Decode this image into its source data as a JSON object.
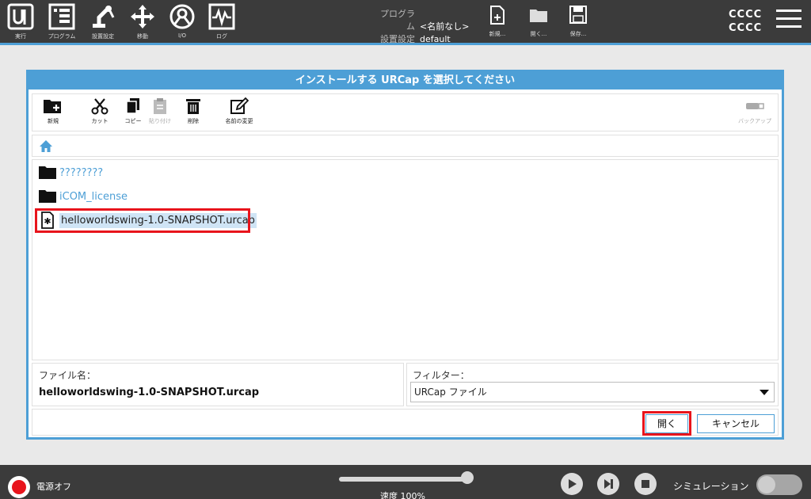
{
  "header": {
    "nav": [
      {
        "label": "実行",
        "icon": "ur-logo-icon"
      },
      {
        "label": "プログラム",
        "icon": "program-icon"
      },
      {
        "label": "設置設定",
        "icon": "robot-arm-icon"
      },
      {
        "label": "移動",
        "icon": "move-icon"
      },
      {
        "label": "I/O",
        "icon": "io-icon"
      },
      {
        "label": "ログ",
        "icon": "log-icon"
      }
    ],
    "program_key": "プログラム",
    "program_value": "<名前なし>",
    "installation_key": "設置設定",
    "installation_value": "default",
    "file_buttons": [
      {
        "label": "新規...",
        "icon": "new-file-icon"
      },
      {
        "label": "開く...",
        "icon": "open-folder-icon"
      },
      {
        "label": "保存...",
        "icon": "save-icon"
      }
    ],
    "robot_line1": "CCCC",
    "robot_line2": "CCCC"
  },
  "dialog": {
    "title": "インストールする URCap を選択してください",
    "toolbar": {
      "new": "新規",
      "cut": "カット",
      "copy": "コピー",
      "paste": "貼り付け",
      "delete": "削除",
      "rename": "名前の変更",
      "backup": "バックアップ"
    },
    "files": [
      {
        "name": "????????",
        "type": "folder"
      },
      {
        "name": "iCOM_license",
        "type": "folder"
      },
      {
        "name": "helloworldswing-1.0-SNAPSHOT.urcap",
        "type": "file",
        "selected": true
      }
    ],
    "filename_label": "ファイル名：",
    "filename_value": "helloworldswing-1.0-SNAPSHOT.urcap",
    "filter_label": "フィルター：",
    "filter_value": "URCap ファイル",
    "open_button": "開く",
    "cancel_button": "キャンセル"
  },
  "footer": {
    "power_label": "電源オフ",
    "speed_label": "速度 100%",
    "speed_percent": 100,
    "simulation_label": "シミュレーション",
    "simulation_on": false
  },
  "colors": {
    "accent": "#4d9fd6",
    "highlight": "#e8141c",
    "header_bg": "#3b3b3b"
  }
}
